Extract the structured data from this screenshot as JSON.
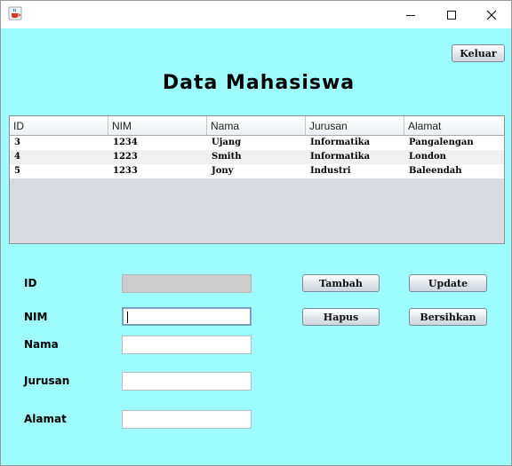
{
  "window": {
    "icons": {
      "app": "java-cup-icon",
      "minimize": "minimize-icon",
      "maximize": "maximize-icon",
      "close": "close-icon"
    }
  },
  "header": {
    "exit_label": "Keluar",
    "title": "Data Mahasiswa"
  },
  "table": {
    "columns": [
      "ID",
      "NIM",
      "Nama",
      "Jurusan",
      "Alamat"
    ],
    "rows": [
      [
        "3",
        "1234",
        "Ujang",
        "Informatika",
        "Pangalengan"
      ],
      [
        "4",
        "1223",
        "Smith",
        "Informatika",
        "London"
      ],
      [
        "5",
        "1233",
        "Jony",
        "Industri",
        "Baleendah"
      ]
    ]
  },
  "form": {
    "id_label": "ID",
    "nim_label": "NIM",
    "nama_label": "Nama",
    "jurusan_label": "Jurusan",
    "alamat_label": "Alamat",
    "id_value": "",
    "nim_value": "",
    "nama_value": "",
    "jurusan_value": "",
    "alamat_value": ""
  },
  "buttons": {
    "tambah": "Tambah",
    "update": "Update",
    "hapus": "Hapus",
    "bersihkan": "Bersihkan"
  },
  "colors": {
    "background": "#9ffcfd",
    "table_empty": "#d8dbe2"
  }
}
